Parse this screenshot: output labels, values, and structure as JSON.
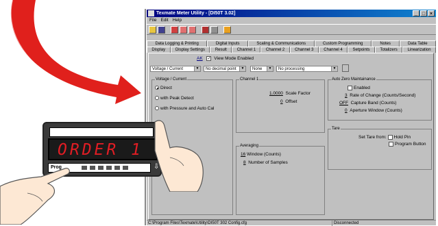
{
  "window": {
    "title": "Texmate Meter Utility  - [DI50T  3.02]"
  },
  "menu": [
    "File",
    "Edit",
    "Help"
  ],
  "tabs_row1": [
    "Data Logging & Printing",
    "Digital Inputs",
    "Scaling & Communications",
    "Custom Programming",
    "Notes",
    "Data Table"
  ],
  "tabs_row2": [
    "Display",
    "Display Settings",
    "Result",
    "Channel 1",
    "Channel 2",
    "Channel 3",
    "Channel 4",
    "Setpoints",
    "Totalizers",
    "Linearization"
  ],
  "mode": {
    "code": "AK",
    "checkbox_label": "View Mode Enabled"
  },
  "selects": [
    "Voltage / Current",
    "No decimal point",
    "None",
    "No processing"
  ],
  "voltage_group": {
    "caption": "Voltage / Current",
    "options": [
      "Direct",
      "with Peak Detect",
      "with Pressure and Auto Cal"
    ]
  },
  "channel_group": {
    "caption": "Channel 1",
    "scale_value": "1.0000",
    "scale_label": "Scale Factor",
    "offset_value": "0",
    "offset_label": "Offset"
  },
  "averaging": {
    "caption": "Averaging",
    "window_value": "16",
    "window_label": "Window (Counts)",
    "samples_value": "8",
    "samples_label": "Number of Samples"
  },
  "autozero": {
    "caption": "Auto Zero Maintainance",
    "enabled_label": "Enabled",
    "rate_value": "3",
    "rate_label": "Rate of Change (Counts/Second)",
    "band_value": "OFF",
    "band_label": "Capture Band (Counts)",
    "aperture_value": "0",
    "aperture_label": "Aperture Window (Counts)"
  },
  "tare": {
    "caption": "Tare",
    "set_label": "Set Tare from:",
    "hold_label": "Hold Pin",
    "program_label": "Program Button"
  },
  "status": {
    "path": "C:\\Program Files\\Texmate\\Utility\\DI50T 302 Config.cfg",
    "connection": "Disconnected"
  },
  "meter": {
    "display": "ORDER 1",
    "prog_label": "Prog"
  },
  "colors": {
    "arrow": "#e0201c",
    "display_bg": "#1a1a1a",
    "led": "#e21d24",
    "titlebar": "#000080"
  }
}
